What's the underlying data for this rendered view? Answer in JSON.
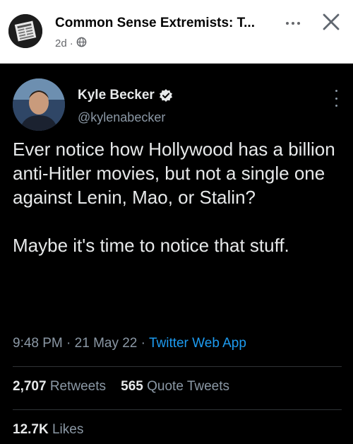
{
  "facebook": {
    "page_name": "Common Sense Extremists: T...",
    "time": "2d",
    "separator": "·",
    "privacy_icon": "globe-icon",
    "more_icon": "ellipsis-icon",
    "close_icon": "close-icon"
  },
  "tweet": {
    "author_name": "Kyle Becker",
    "verified_icon": "verified-badge-icon",
    "handle": "@kylenabecker",
    "paragraphs": [
      "Ever notice how Hollywood has a billion anti-Hitler movies, but not a single one against Lenin, Mao, or Stalin?",
      "Maybe it's time to notice that stuff."
    ],
    "time": "9:48 PM",
    "date": "21 May 22",
    "source": "Twitter Web App",
    "retweets_count": "2,707",
    "retweets_label": "Retweets",
    "quote_count": "565",
    "quote_label": "Quote Tweets",
    "likes_count": "12.7K",
    "likes_label": "Likes"
  },
  "colors": {
    "background": "#000000",
    "text": "#e7e9ea",
    "muted": "#8b98a5",
    "link": "#1d9bf0",
    "verified": "#e7e9ea"
  }
}
